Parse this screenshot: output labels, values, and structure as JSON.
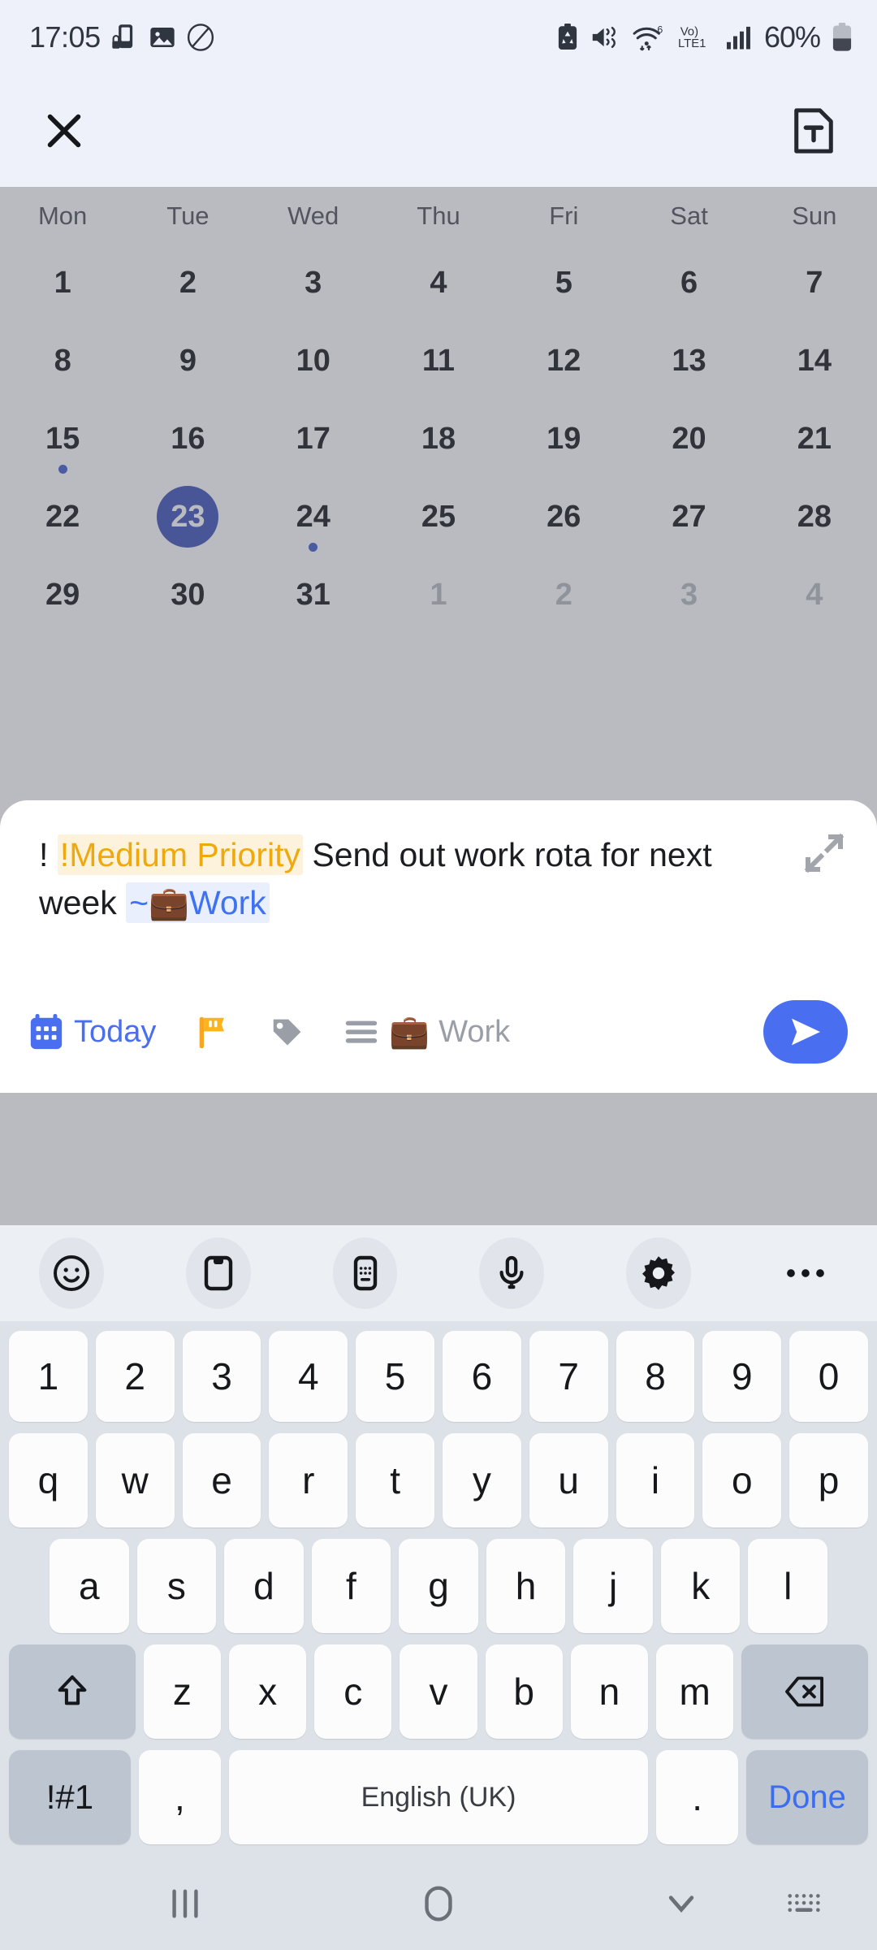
{
  "status_bar": {
    "time": "17:05",
    "battery_percent": "60%",
    "network_label": "LTE1",
    "volte_label": "Vo)",
    "wifi_gen": "6",
    "icons": [
      "phone-lock-icon",
      "gallery-icon",
      "no-sim-icon",
      "battery-protect-icon",
      "mute-vibrate-icon",
      "wifi-icon",
      "volte-icon",
      "signal-bars-icon",
      "battery-icon"
    ]
  },
  "app_header": {
    "close_label": "close-icon",
    "note_label": "text-note-icon"
  },
  "calendar": {
    "day_names": [
      "Mon",
      "Tue",
      "Wed",
      "Thu",
      "Fri",
      "Sat",
      "Sun"
    ],
    "weeks": [
      [
        {
          "num": "1",
          "other": false,
          "dot": false,
          "selected": false
        },
        {
          "num": "2",
          "other": false,
          "dot": false,
          "selected": false
        },
        {
          "num": "3",
          "other": false,
          "dot": false,
          "selected": false
        },
        {
          "num": "4",
          "other": false,
          "dot": false,
          "selected": false
        },
        {
          "num": "5",
          "other": false,
          "dot": false,
          "selected": false
        },
        {
          "num": "6",
          "other": false,
          "dot": false,
          "selected": false
        },
        {
          "num": "7",
          "other": false,
          "dot": false,
          "selected": false
        }
      ],
      [
        {
          "num": "8",
          "other": false,
          "dot": false,
          "selected": false
        },
        {
          "num": "9",
          "other": false,
          "dot": false,
          "selected": false
        },
        {
          "num": "10",
          "other": false,
          "dot": false,
          "selected": false
        },
        {
          "num": "11",
          "other": false,
          "dot": false,
          "selected": false
        },
        {
          "num": "12",
          "other": false,
          "dot": false,
          "selected": false
        },
        {
          "num": "13",
          "other": false,
          "dot": false,
          "selected": false
        },
        {
          "num": "14",
          "other": false,
          "dot": false,
          "selected": false
        }
      ],
      [
        {
          "num": "15",
          "other": false,
          "dot": true,
          "selected": false
        },
        {
          "num": "16",
          "other": false,
          "dot": false,
          "selected": false
        },
        {
          "num": "17",
          "other": false,
          "dot": false,
          "selected": false
        },
        {
          "num": "18",
          "other": false,
          "dot": false,
          "selected": false
        },
        {
          "num": "19",
          "other": false,
          "dot": false,
          "selected": false
        },
        {
          "num": "20",
          "other": false,
          "dot": false,
          "selected": false
        },
        {
          "num": "21",
          "other": false,
          "dot": false,
          "selected": false
        }
      ],
      [
        {
          "num": "22",
          "other": false,
          "dot": false,
          "selected": false
        },
        {
          "num": "23",
          "other": false,
          "dot": false,
          "selected": true
        },
        {
          "num": "24",
          "other": false,
          "dot": true,
          "selected": false
        },
        {
          "num": "25",
          "other": false,
          "dot": false,
          "selected": false
        },
        {
          "num": "26",
          "other": false,
          "dot": false,
          "selected": false
        },
        {
          "num": "27",
          "other": false,
          "dot": false,
          "selected": false
        },
        {
          "num": "28",
          "other": false,
          "dot": false,
          "selected": false
        }
      ],
      [
        {
          "num": "29",
          "other": false,
          "dot": false,
          "selected": false
        },
        {
          "num": "30",
          "other": false,
          "dot": false,
          "selected": false
        },
        {
          "num": "31",
          "other": false,
          "dot": false,
          "selected": false
        },
        {
          "num": "1",
          "other": true,
          "dot": false,
          "selected": false
        },
        {
          "num": "2",
          "other": true,
          "dot": false,
          "selected": false
        },
        {
          "num": "3",
          "other": true,
          "dot": false,
          "selected": false
        },
        {
          "num": "4",
          "other": true,
          "dot": false,
          "selected": false
        }
      ]
    ],
    "selected_day": "23",
    "accent_color": "#3d5ccc"
  },
  "task_sheet": {
    "text_prefix": "! ",
    "priority_token": "!Medium Priority",
    "body_text": " Send out work rota for next week ",
    "project_prefix": "~",
    "project_emoji": "💼",
    "project_token": "Work",
    "priority_color": "#f0a90d",
    "project_color": "#3f72f0",
    "expand_icon": "expand-icon"
  },
  "toolbar": {
    "date_label": "Today",
    "priority_icon": "flag-icon",
    "tag_icon": "tag-icon",
    "list_icon": "list-icon",
    "project_emoji": "💼",
    "project_label": "Work",
    "send_icon": "send-icon",
    "accent_color": "#4a6ef0"
  },
  "keyboard_toolbar": {
    "items": [
      "emoji-icon",
      "clipboard-icon",
      "handwriting-icon",
      "microphone-icon",
      "settings-gear-icon",
      "more-options-icon"
    ]
  },
  "keyboard": {
    "row_numbers": [
      "1",
      "2",
      "3",
      "4",
      "5",
      "6",
      "7",
      "8",
      "9",
      "0"
    ],
    "row_top": [
      "q",
      "w",
      "e",
      "r",
      "t",
      "y",
      "u",
      "i",
      "o",
      "p"
    ],
    "row_home": [
      "a",
      "s",
      "d",
      "f",
      "g",
      "h",
      "j",
      "k",
      "l"
    ],
    "row_bottom": [
      "z",
      "x",
      "c",
      "v",
      "b",
      "n",
      "m"
    ],
    "shift_label": "shift-icon",
    "backspace_label": "backspace-icon",
    "symbols_label": "!#1",
    "comma_label": ",",
    "space_label": "English (UK)",
    "period_label": ".",
    "done_label": "Done"
  },
  "nav_bar": {
    "recents_label": "recents-icon",
    "home_label": "home-icon",
    "hide_keyboard_label": "hide-keyboard-icon",
    "keyboard_switch_label": "keyboard-switch-icon"
  }
}
